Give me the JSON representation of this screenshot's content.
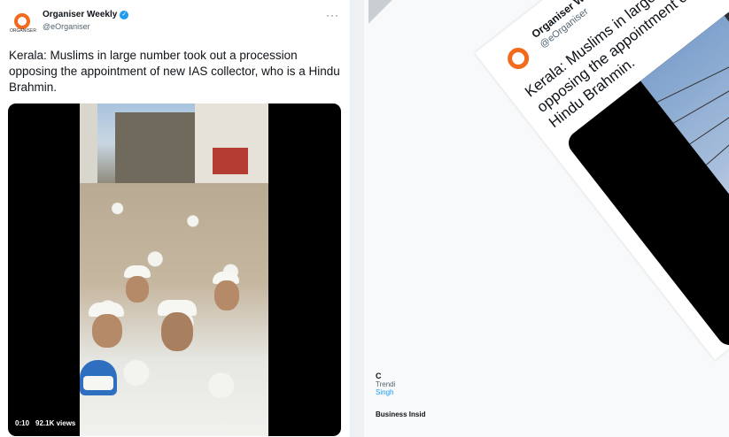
{
  "left_tweet": {
    "account_name": "Organiser Weekly",
    "handle": "@eOrganiser",
    "avatar_caption": "ORGANISER",
    "more_menu": "···",
    "text": "Kerala: Muslims in large number took out a procession opposing the appointment of new IAS collector, who is a Hindu Brahmin.",
    "video_time": "0:10",
    "video_views": "92.1K views"
  },
  "right_screenshot": {
    "account_name": "Organiser Weekly",
    "handle": "@eOrganiser",
    "text": "Kerala: Muslims in large number took out a procession opposing the appointment of new IAS collector, who is a Hindu Brahmin.",
    "sidebar": {
      "fragment_letter": "C",
      "trending_label": "Trendi",
      "trend_name": "Singh",
      "business_label": "Business Insid"
    },
    "edge_fragment": "t"
  },
  "colors": {
    "brand_orange": "#f26a1b",
    "verified_blue": "#1d9bf0",
    "text_primary": "#0f1419",
    "text_secondary": "#536471"
  },
  "icons": [
    "verified-badge-icon",
    "more-options-icon",
    "organiser-logo-icon"
  ]
}
